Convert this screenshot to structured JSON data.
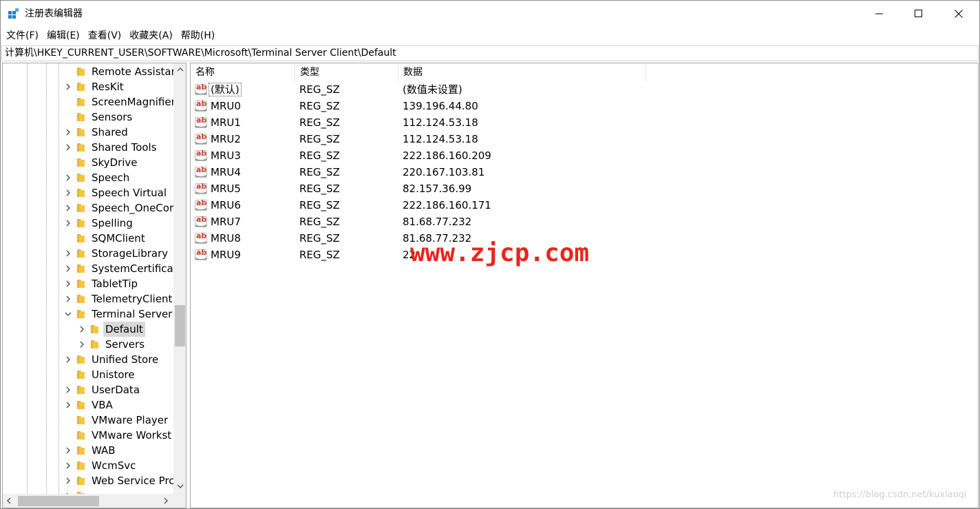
{
  "window": {
    "title": "注册表编辑器",
    "icons": {
      "app": "regedit-icon",
      "min": "minimize-icon",
      "max": "maximize-icon",
      "close": "close-icon"
    }
  },
  "menu": [
    "文件(F)",
    "编辑(E)",
    "查看(V)",
    "收藏夹(A)",
    "帮助(H)"
  ],
  "address": "计算机\\HKEY_CURRENT_USER\\SOFTWARE\\Microsoft\\Terminal Server Client\\Default",
  "tree": {
    "items": [
      {
        "label": "Remote Assistar",
        "expander": "none",
        "level": 0
      },
      {
        "label": "ResKit",
        "expander": "collapsed",
        "level": 0
      },
      {
        "label": "ScreenMagnifier",
        "expander": "none",
        "level": 0
      },
      {
        "label": "Sensors",
        "expander": "none",
        "level": 0
      },
      {
        "label": "Shared",
        "expander": "collapsed",
        "level": 0
      },
      {
        "label": "Shared Tools",
        "expander": "collapsed",
        "level": 0
      },
      {
        "label": "SkyDrive",
        "expander": "none",
        "level": 0
      },
      {
        "label": "Speech",
        "expander": "collapsed",
        "level": 0
      },
      {
        "label": "Speech Virtual",
        "expander": "collapsed",
        "level": 0
      },
      {
        "label": "Speech_OneCor",
        "expander": "collapsed",
        "level": 0
      },
      {
        "label": "Spelling",
        "expander": "collapsed",
        "level": 0
      },
      {
        "label": "SQMClient",
        "expander": "none",
        "level": 0
      },
      {
        "label": "StorageLibrary",
        "expander": "collapsed",
        "level": 0
      },
      {
        "label": "SystemCertificat",
        "expander": "collapsed",
        "level": 0
      },
      {
        "label": "TabletTip",
        "expander": "collapsed",
        "level": 0
      },
      {
        "label": "TelemetryClient",
        "expander": "collapsed",
        "level": 0
      },
      {
        "label": "Terminal Server",
        "expander": "expanded",
        "level": 0
      },
      {
        "label": "Default",
        "expander": "collapsed",
        "level": 1,
        "selected": true
      },
      {
        "label": "Servers",
        "expander": "collapsed",
        "level": 1
      },
      {
        "label": "Unified Store",
        "expander": "collapsed",
        "level": 0
      },
      {
        "label": "Unistore",
        "expander": "none",
        "level": 0
      },
      {
        "label": "UserData",
        "expander": "collapsed",
        "level": 0
      },
      {
        "label": "VBA",
        "expander": "collapsed",
        "level": 0
      },
      {
        "label": "VMware Player",
        "expander": "none",
        "level": 0
      },
      {
        "label": "VMware Workst",
        "expander": "none",
        "level": 0
      },
      {
        "label": "WAB",
        "expander": "collapsed",
        "level": 0
      },
      {
        "label": "WcmSvc",
        "expander": "collapsed",
        "level": 0
      },
      {
        "label": "Web Service Prc",
        "expander": "collapsed",
        "level": 0
      },
      {
        "label": "",
        "expander": "collapsed",
        "level": 0
      }
    ],
    "vscroll_position": 0.6
  },
  "list": {
    "columns": [
      "名称",
      "类型",
      "数据"
    ],
    "rows": [
      {
        "name": "(默认)",
        "type": "REG_SZ",
        "data": "(数值未设置)",
        "focused": true
      },
      {
        "name": "MRU0",
        "type": "REG_SZ",
        "data": "139.196.44.80"
      },
      {
        "name": "MRU1",
        "type": "REG_SZ",
        "data": "112.124.53.18"
      },
      {
        "name": "MRU2",
        "type": "REG_SZ",
        "data": "112.124.53.18"
      },
      {
        "name": "MRU3",
        "type": "REG_SZ",
        "data": "222.186.160.209"
      },
      {
        "name": "MRU4",
        "type": "REG_SZ",
        "data": "220.167.103.81"
      },
      {
        "name": "MRU5",
        "type": "REG_SZ",
        "data": "82.157.36.99"
      },
      {
        "name": "MRU6",
        "type": "REG_SZ",
        "data": "222.186.160.171"
      },
      {
        "name": "MRU7",
        "type": "REG_SZ",
        "data": "81.68.77.232"
      },
      {
        "name": "MRU8",
        "type": "REG_SZ",
        "data": "81.68.77.232"
      },
      {
        "name": "MRU9",
        "type": "REG_SZ",
        "data": "22"
      }
    ],
    "value_icon": "reg-string-value-icon"
  },
  "watermark": "www.zjcp.com",
  "csdn_watermark": "https://blog.csdn.net/kuxiaoqi",
  "colors": {
    "watermark": "#e8261c",
    "folder": "#f5c542",
    "selection": "#d9d9d9",
    "icon_red": "#c93a2b"
  }
}
